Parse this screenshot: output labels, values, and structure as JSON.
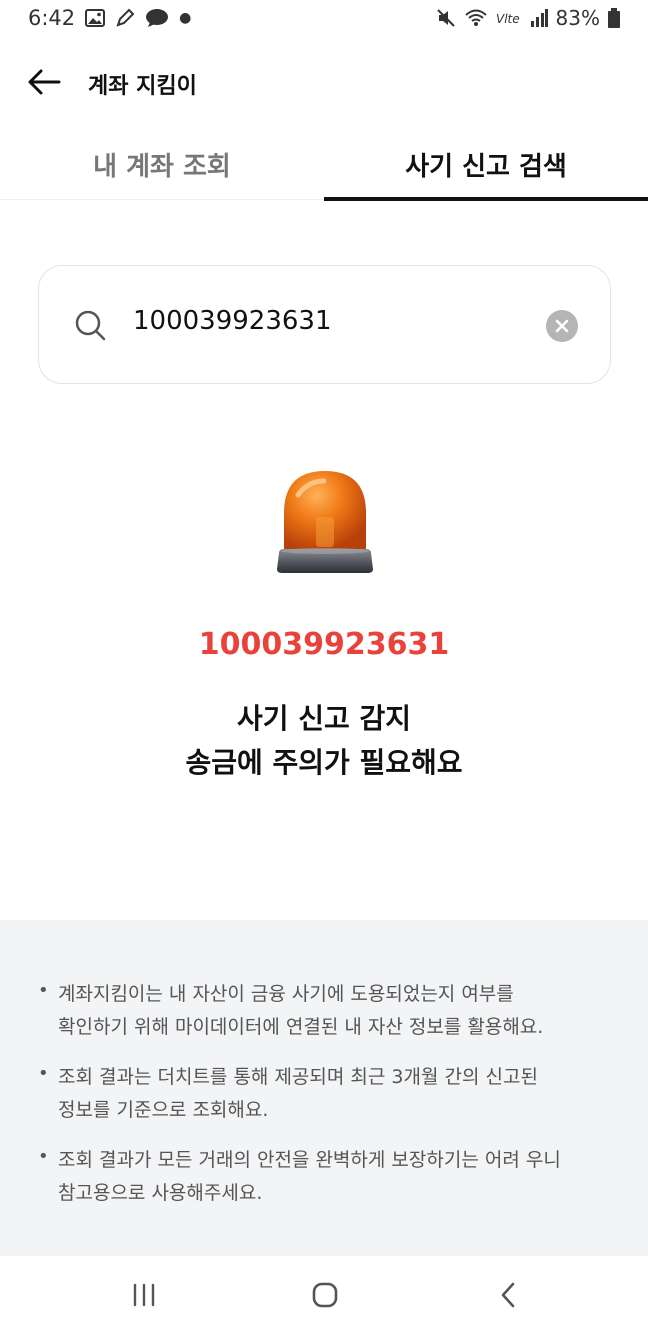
{
  "status_bar": {
    "time": "6:42",
    "battery": "83%"
  },
  "header": {
    "title": "계좌 지킴이"
  },
  "tabs": [
    {
      "label": "내 계좌 조회",
      "active": false
    },
    {
      "label": "사기 신고 검색",
      "active": true
    }
  ],
  "search": {
    "value": "100039923631"
  },
  "result": {
    "number": "100039923631",
    "line1": "사기 신고 감지",
    "line2": "송금에 주의가 필요해요"
  },
  "info": [
    {
      "line1": "계좌지킴이는 내 자산이 금융 사기에 도용되었는지 여부를",
      "line2": "확인하기 위해 마이데이터에 연결된 내 자산 정보를 활용해요."
    },
    {
      "line1": "조회 결과는 더치트를 통해 제공되며 최근 3개월 간의 신고된",
      "line2": "정보를 기준으로 조회해요."
    },
    {
      "line1": "조회 결과가 모든 거래의 안전을 완벽하게 보장하기는 어려 우니",
      "line2": "참고용으로 사용해주세요."
    }
  ],
  "colors": {
    "alert_red": "#e8423b",
    "panel_bg": "#f3f4f6"
  }
}
